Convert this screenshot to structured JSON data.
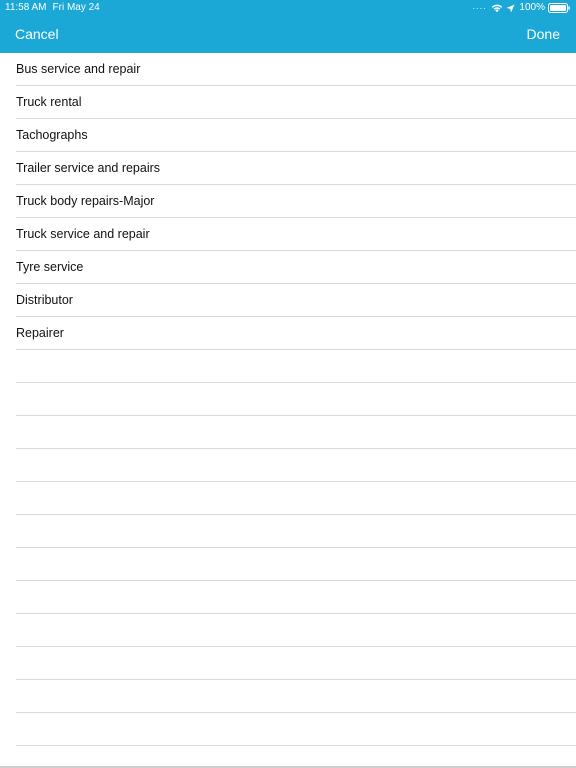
{
  "status_bar": {
    "time": "11:58 AM",
    "date": "Fri May 24",
    "battery": "100%",
    "icons": [
      "signal-dots-icon",
      "wifi-icon",
      "location-arrow-icon",
      "battery-icon"
    ]
  },
  "nav": {
    "cancel_label": "Cancel",
    "done_label": "Done"
  },
  "items": [
    {
      "label": "Bus service and repair"
    },
    {
      "label": "Truck rental"
    },
    {
      "label": "Tachographs"
    },
    {
      "label": "Trailer service and repairs"
    },
    {
      "label": "Truck body repairs-Major"
    },
    {
      "label": "Truck service and repair"
    },
    {
      "label": "Tyre service"
    },
    {
      "label": "Distributor"
    },
    {
      "label": "Repairer"
    }
  ],
  "colors": {
    "header": "#1ba8d6",
    "header_text": "#ffffff",
    "separator": "#d9d9d9",
    "row_text": "#111111"
  }
}
